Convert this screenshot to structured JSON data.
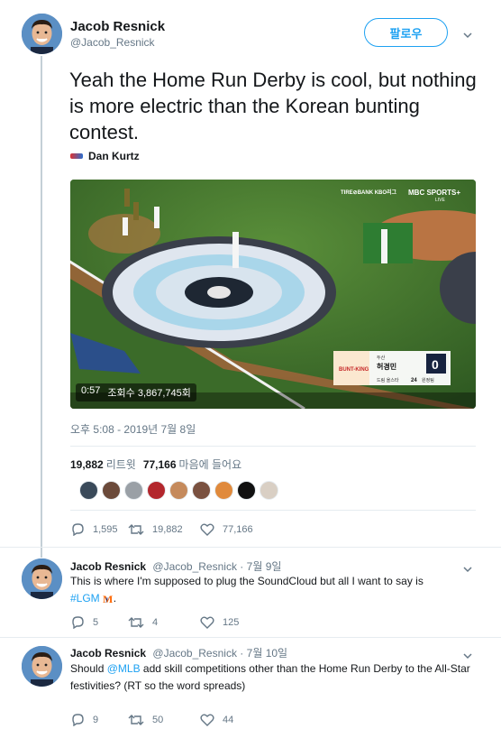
{
  "main_tweet": {
    "author_name": "Jacob Resnick",
    "author_handle": "@Jacob_Resnick",
    "follow_label": "팔로우",
    "text": "Yeah the Home Run Derby is cool, but nothing is more electric than the Korean bunting contest.",
    "attribution": "Dan Kurtz",
    "video": {
      "duration": "0:57",
      "views": "조회수 3,867,745회",
      "overlay_brand": "TIRE⊘BANK KBO리그",
      "overlay_network": "MBC SPORTS+",
      "overlay_live": "LIVE",
      "scoreboard_team": "두산",
      "scoreboard_player": "허경민",
      "scoreboard_score": "0",
      "scoreboard_sub": "드림 올스타",
      "scoreboard_num": "24",
      "scoreboard_sub2": "원정팀",
      "scoreboard_logo": "BUNT-KING"
    },
    "timestamp": "오후 5:08 - 2019년 7월 8일",
    "retweets_count": "19,882",
    "retweets_label": "리트윗",
    "likes_count": "77,166",
    "likes_label": "마음에 들어요",
    "actions": {
      "replies": "1,595",
      "retweets": "19,882",
      "likes": "77,166"
    }
  },
  "replies": [
    {
      "author_name": "Jacob Resnick",
      "author_handle": "@Jacob_Resnick",
      "date": "7월 9일",
      "text_before": "This is where I'm supposed to plug the SoundCloud but all I want to say is",
      "hashtag": "#LGM",
      "text_after": ".",
      "actions": {
        "replies": "5",
        "retweets": "4",
        "likes": "125"
      }
    },
    {
      "author_name": "Jacob Resnick",
      "author_handle": "@Jacob_Resnick",
      "date": "7월 10일",
      "text_before": "Should",
      "mention": "@MLB",
      "text_after": "add skill competitions other than the Home Run Derby to the All-Star festivities? (RT so the word spreads)",
      "actions": {
        "replies": "9",
        "retweets": "50",
        "likes": "44"
      }
    }
  ],
  "colors": {
    "accent": "#1da1f2",
    "secondary_text": "#657786",
    "thread_line": "#c4cfd6"
  },
  "icons": [
    "caret-down-icon",
    "reply-icon",
    "retweet-icon",
    "like-icon",
    "mets-logo-icon"
  ]
}
